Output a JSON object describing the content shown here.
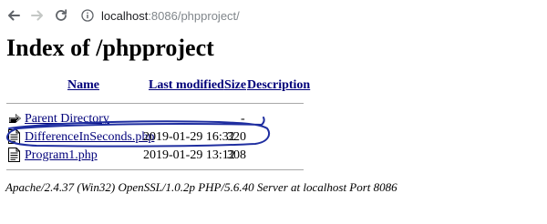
{
  "browser": {
    "url_host": "localhost",
    "url_path": ":8086/phpproject/"
  },
  "page": {
    "title": "Index of /phpproject",
    "columns": {
      "name": "Name",
      "last_modified": "Last modified",
      "size": "Size",
      "description": "Description"
    },
    "parent": {
      "label": "Parent Directory",
      "size": "-"
    },
    "files": [
      {
        "name": "DifferenceInSeconds.php",
        "modified": "2019-01-29 16:32",
        "size": "320"
      },
      {
        "name": "Program1.php",
        "modified": "2019-01-29 13:12",
        "size": "308"
      }
    ],
    "footer": "Apache/2.4.37 (Win32) OpenSSL/1.0.2p PHP/5.6.40 Server at localhost Port 8086"
  },
  "colors": {
    "link": "#00007a",
    "annotation": "#1f2ea0"
  },
  "icons": [
    "back-arrow-icon",
    "forward-arrow-icon",
    "reload-icon",
    "info-icon",
    "back-folder-icon",
    "file-icon"
  ]
}
